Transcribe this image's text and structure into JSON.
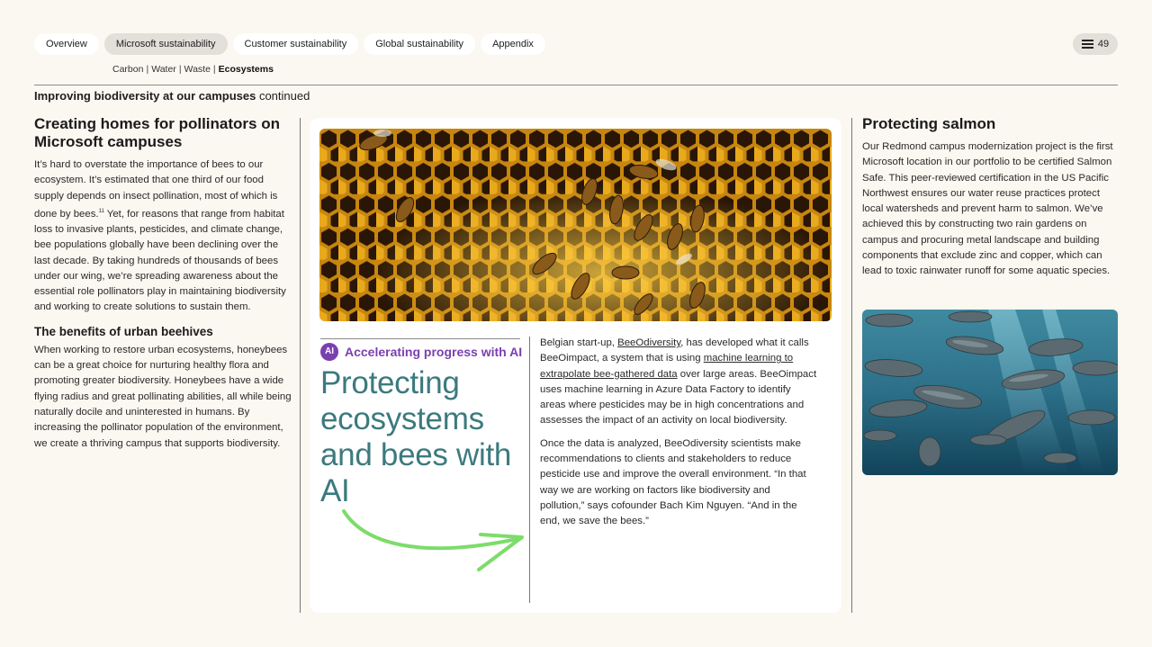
{
  "nav": {
    "tabs": [
      {
        "label": "Overview"
      },
      {
        "label": "Microsoft sustainability"
      },
      {
        "label": "Customer sustainability"
      },
      {
        "label": "Global sustainability"
      },
      {
        "label": "Appendix"
      }
    ],
    "active_tab": "Microsoft sustainability",
    "page_number": "49",
    "menu_icon": "hamburger-menu-icon"
  },
  "subnav": {
    "items": [
      "Carbon",
      "Water",
      "Waste",
      "Ecosystems"
    ],
    "current": "Ecosystems"
  },
  "section": {
    "title_bold": "Improving biodiversity at our campuses",
    "title_rest": " continued"
  },
  "left": {
    "heading": "Creating homes for pollinators on Microsoft campuses",
    "para1_a": "It’s hard to overstate the importance of bees to our ecosystem. It’s estimated that one third of our food supply depends on insect pollination, most of which is done by bees.",
    "para1_sup": "11",
    "para1_b": " Yet, for reasons that range from habitat loss to invasive plants, pesticides, and climate change, bee populations globally have been declining over the last decade. By taking hundreds of thousands of bees under our wing, we’re spreading awareness about the essential role pollinators play in maintaining biodiversity and working to create solutions to sustain them.",
    "subheading": "The benefits of urban beehives",
    "para2": "When working to restore urban ecosystems, honeybees can be a great choice for nurturing healthy flora and promoting greater biodiversity. Honeybees have a wide flying radius and great pollinating abilities, all while being naturally docile and uninterested in humans. By increasing the pollinator population of the environment, we create a thriving campus that supports biodiversity."
  },
  "card": {
    "ai_badge": "AI",
    "ai_label": "Accelerating progress with AI",
    "big_title": "Protecting ecosystems and bees with AI",
    "p1_a": "Belgian start-up, ",
    "p1_link1": "BeeOdiversity",
    "p1_b": ", has developed what it calls BeeOimpact, a system that is using ",
    "p1_link2": "machine learning to extrapolate bee-gathered data",
    "p1_c": " over large areas. BeeOimpact uses machine learning in Azure Data Factory to identify areas where pesticides may be in high concentrations and assesses the impact of an activity on local biodiversity.",
    "p2": "Once the data is analyzed, BeeOdiversity scientists make recommendations to clients and stakeholders to reduce pesticide use and improve the overall environment. “In that way we are working on factors like biodiversity and pollution,” says cofounder Bach Kim Nguyen. “And in the end, we save the bees.”",
    "arrow_color": "#7ddc6a",
    "accent_purple": "#7b3fb0",
    "title_teal": "#3c7a7e"
  },
  "right": {
    "heading": "Protecting salmon",
    "para": "Our Redmond campus modernization project is the first Microsoft location in our portfolio to be certified Salmon Safe. This peer-reviewed certification in the US Pacific Northwest ensures our water reuse practices protect local watersheds and prevent harm to salmon. We’ve achieved this by constructing two rain gardens on campus and procuring metal landscape and building components that exclude zinc and copper, which can lead to toxic rainwater runoff for some aquatic species."
  }
}
